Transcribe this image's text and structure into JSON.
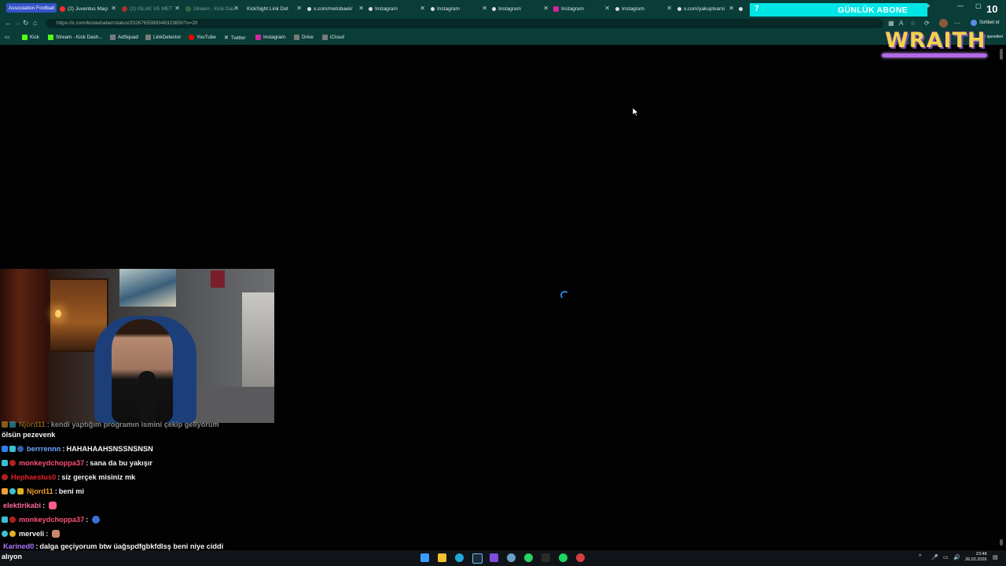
{
  "browser": {
    "tabs": [
      {
        "label": "Association Football",
        "active": true
      },
      {
        "label": "(2) Juventus Maçı"
      },
      {
        "label": "(2) ISLAK VE MET"
      },
      {
        "label": "Stream - Kick Das"
      },
      {
        "label": "KickSight Link Det"
      },
      {
        "label": "x.com/metobaek/"
      },
      {
        "label": "Instagram"
      },
      {
        "label": "Instagram"
      },
      {
        "label": "Instagram"
      },
      {
        "label": "Instagram"
      },
      {
        "label": "Instagram"
      },
      {
        "label": "x.com/yakuptvarsi"
      }
    ],
    "new_tab": "+",
    "url": "https://x.com/kistashaber/status/2026765589348323650?s=20",
    "chat_button": "Sohbet et",
    "bookmarks": [
      {
        "label": "Kick",
        "color": "#53fc18"
      },
      {
        "label": "Stream - Kick Dash...",
        "color": "#53fc18"
      },
      {
        "label": "AdSquad",
        "color": "#7a7a7a"
      },
      {
        "label": "LinkDetector",
        "color": "#7a7a7a"
      },
      {
        "label": "YouTube",
        "color": "#ff0000"
      },
      {
        "label": "Twitter",
        "color": "#ffffff"
      },
      {
        "label": "Instagram",
        "color": "#d6249f"
      },
      {
        "label": "Drive",
        "color": "#7a7a7a"
      },
      {
        "label": "iCloud",
        "color": "#7a7a7a"
      }
    ],
    "bookmarks_right": "Yer işaretleri"
  },
  "overlay": {
    "sub_goal_count": "7",
    "sub_goal_label": "GÜNLÜK ABONE",
    "top_count": "10",
    "logo_text": "WRAITH"
  },
  "chat": {
    "messages": [
      {
        "user": "Njord11",
        "text": "kendi yaptığım programın ismini çekip geliyorum",
        "color": "#f0a030"
      },
      {
        "user": "",
        "text": "ölsün pezevenk",
        "color": "#f2f2f2"
      },
      {
        "user": "berrrennn",
        "text": "HAHAHAAHSNSSNSNSN",
        "color": "#6aa8ff"
      },
      {
        "user": "monkeydchoppa37",
        "text": "sana da bu yakışır",
        "color": "#ff4f7a"
      },
      {
        "user": "Hephaestus0",
        "text": "siz gerçek misiniz mk",
        "color": "#e8202a"
      },
      {
        "user": "Njord11",
        "text": "beni mi",
        "color": "#f0a030"
      },
      {
        "user": "elektirikabi",
        "text": "",
        "color": "#ff6b9a"
      },
      {
        "user": "monkeydchoppa37",
        "text": "",
        "color": "#ff4f7a"
      },
      {
        "user": "merveli",
        "text": "",
        "color": "#f2f2f2"
      },
      {
        "user": "Karined0",
        "text": "dalga geçiyorum btw üağspdfgbkfdlsş beni niye ciddi",
        "color": "#b07aff"
      },
      {
        "user": "alıyon",
        "text": "",
        "color": "#f2f2f2"
      }
    ]
  },
  "taskbar": {
    "clock_time": "23:48",
    "clock_date": "26.02.2026"
  }
}
